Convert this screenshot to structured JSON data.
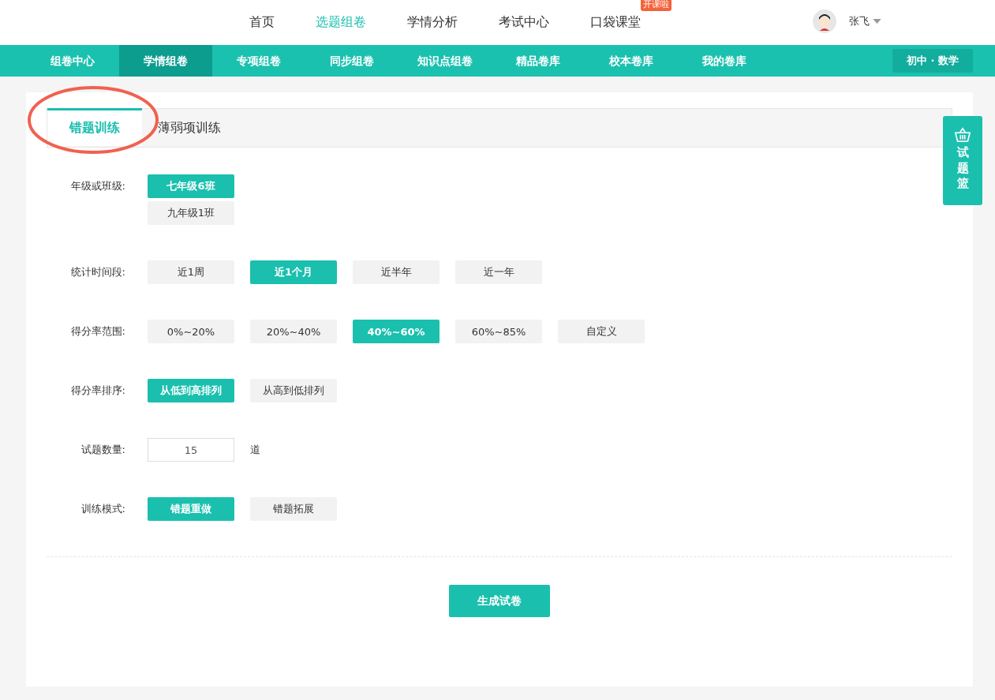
{
  "top_nav": {
    "items": [
      {
        "label": "首页",
        "selected": false
      },
      {
        "label": "选题组卷",
        "selected": true
      },
      {
        "label": "学情分析",
        "selected": false
      },
      {
        "label": "考试中心",
        "selected": false
      },
      {
        "label": "口袋课堂",
        "selected": false,
        "badge": "开课啦"
      }
    ],
    "user": "张飞"
  },
  "sub_nav": {
    "items": [
      {
        "label": "组卷中心",
        "selected": false
      },
      {
        "label": "学情组卷",
        "selected": true
      },
      {
        "label": "专项组卷",
        "selected": false
      },
      {
        "label": "同步组卷",
        "selected": false
      },
      {
        "label": "知识点组卷",
        "selected": false
      },
      {
        "label": "精品卷库",
        "selected": false
      },
      {
        "label": "校本卷库",
        "selected": false
      },
      {
        "label": "我的卷库",
        "selected": false
      }
    ],
    "subject": "初中 · 数学"
  },
  "tabs": [
    {
      "label": "错题训练",
      "selected": true
    },
    {
      "label": "薄弱项训练",
      "selected": false
    }
  ],
  "form": [
    {
      "label": "年级或班级:",
      "kind": "stacked",
      "options": [
        {
          "label": "七年级6班",
          "selected": true
        },
        {
          "label": "九年级1班",
          "selected": false
        }
      ]
    },
    {
      "label": "统计时间段:",
      "kind": "options",
      "options": [
        {
          "label": "近1周",
          "selected": false
        },
        {
          "label": "近1个月",
          "selected": true
        },
        {
          "label": "近半年",
          "selected": false
        },
        {
          "label": "近一年",
          "selected": false
        }
      ]
    },
    {
      "label": "得分率范围:",
      "kind": "options",
      "options": [
        {
          "label": "0%~20%",
          "selected": false
        },
        {
          "label": "20%~40%",
          "selected": false
        },
        {
          "label": "40%~60%",
          "selected": true
        },
        {
          "label": "60%~85%",
          "selected": false
        },
        {
          "label": "自定义",
          "selected": false
        }
      ]
    },
    {
      "label": "得分率排序:",
      "kind": "options",
      "options": [
        {
          "label": "从低到高排列",
          "selected": true
        },
        {
          "label": "从高到低排列",
          "selected": false
        }
      ]
    },
    {
      "label": "试题数量:",
      "kind": "number",
      "value": "15",
      "unit": "道"
    },
    {
      "label": "训练模式:",
      "kind": "options",
      "options": [
        {
          "label": "错题重做",
          "selected": true
        },
        {
          "label": "错题拓展",
          "selected": false
        }
      ]
    }
  ],
  "generate_button": "生成试卷",
  "basket": "试题篮"
}
